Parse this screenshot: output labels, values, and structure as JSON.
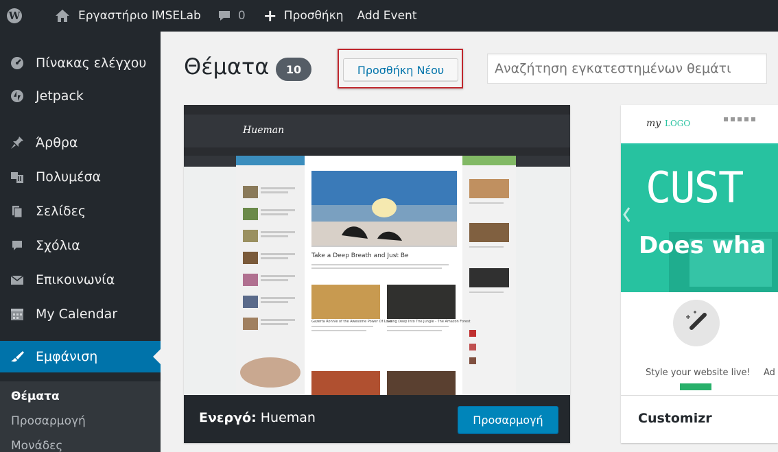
{
  "adminbar": {
    "site_name": "Εργαστήριο IMSELab",
    "comments_count": "0",
    "new_label": "Προσθήκη",
    "add_event": "Add Event"
  },
  "sidebar": {
    "items": [
      {
        "label": "Πίνακας ελέγχου",
        "icon": "dashboard-icon"
      },
      {
        "label": "Jetpack",
        "icon": "jetpack-icon"
      },
      {
        "label": "Άρθρα",
        "icon": "pin-icon"
      },
      {
        "label": "Πολυμέσα",
        "icon": "media-icon"
      },
      {
        "label": "Σελίδες",
        "icon": "pages-icon"
      },
      {
        "label": "Σχόλια",
        "icon": "comment-icon"
      },
      {
        "label": "Επικοινωνία",
        "icon": "mail-icon"
      },
      {
        "label": "My Calendar",
        "icon": "calendar-icon"
      },
      {
        "label": "Εμφάνιση",
        "icon": "appearance-icon"
      }
    ],
    "submenu": [
      "Θέματα",
      "Προσαρμογή",
      "Μονάδες"
    ]
  },
  "page": {
    "title": "Θέματα",
    "count": "10",
    "add_new": "Προσθήκη Νέου",
    "search_placeholder": "Αναζήτηση εγκατεστημένων θεμάτι"
  },
  "themes": {
    "active": {
      "prefix": "Ενεργό:",
      "name": "Hueman",
      "customize": "Προσαρμογή",
      "screenshot": {
        "logo": "Hueman",
        "post_title": "Take a Deep Breath and Just Be",
        "post2": "Gazerta Ronnie of the Awesome Power Of Love",
        "post3": "Going Deep Into The Jungle - The Amazon Forest"
      }
    },
    "second": {
      "name": "Customizr",
      "screenshot": {
        "logo_my": "my",
        "logo_text": "LOGO",
        "hero": "CUST",
        "tagline": "Does wha",
        "feature": "Style your website live!",
        "feature2": "Ad"
      }
    }
  }
}
